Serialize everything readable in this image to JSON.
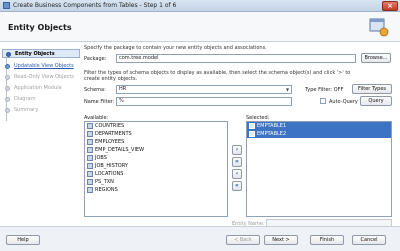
{
  "window": {
    "title": "Create Business Components from Tables - Step 1 of 6",
    "close_label": "×"
  },
  "header": {
    "title": "Entity Objects"
  },
  "sidebar": {
    "steps": [
      {
        "label": "Entity Objects",
        "state": "active"
      },
      {
        "label": "Updatable View Objects",
        "state": "link"
      },
      {
        "label": "Read-Only View Objects",
        "state": "disabled"
      },
      {
        "label": "Application Module",
        "state": "disabled"
      },
      {
        "label": "Diagram",
        "state": "disabled"
      },
      {
        "label": "Summary",
        "state": "disabled"
      }
    ]
  },
  "main": {
    "intro": "Specify the package to contain your new entity objects and associations.",
    "package_label": "Package:",
    "package_value": "com.tree.model",
    "browse_label": "Browse...",
    "description": "Filter the types of schema objects to display as available, then select the schema object(s) and click '>' to create entity objects.",
    "schema_label": "Schema:",
    "schema_value": "HR",
    "type_filter_label": "Type Filter: OFF",
    "filter_types_label": "Filter Types",
    "name_filter_label": "Name Filter:",
    "name_filter_value": "%",
    "auto_query_label": "Auto-Query",
    "query_label": "Query",
    "available_label": "Available:",
    "selected_label": "Selected:",
    "available_items": [
      "COUNTRIES",
      "DEPARTMENTS",
      "EMPLOYEES",
      "EMP_DETAILS_VIEW",
      "JOBS",
      "JOB_HISTORY",
      "LOCATIONS",
      "PS_TXN",
      "REGIONS"
    ],
    "selected_items": [
      "EMPTABLE1",
      "EMPTABLE2"
    ],
    "shuttle": {
      "add": "›",
      "add_all": "»",
      "remove": "‹",
      "remove_all": "«"
    },
    "entity_name_label": "Entity Name:"
  },
  "footer": {
    "help": "Help",
    "back": "< Back",
    "next": "Next >",
    "finish": "Finish",
    "cancel": "Cancel"
  },
  "colors": {
    "accent": "#3d73c3",
    "link": "#2b5bb0",
    "header_bg": "#f7f8fa"
  }
}
